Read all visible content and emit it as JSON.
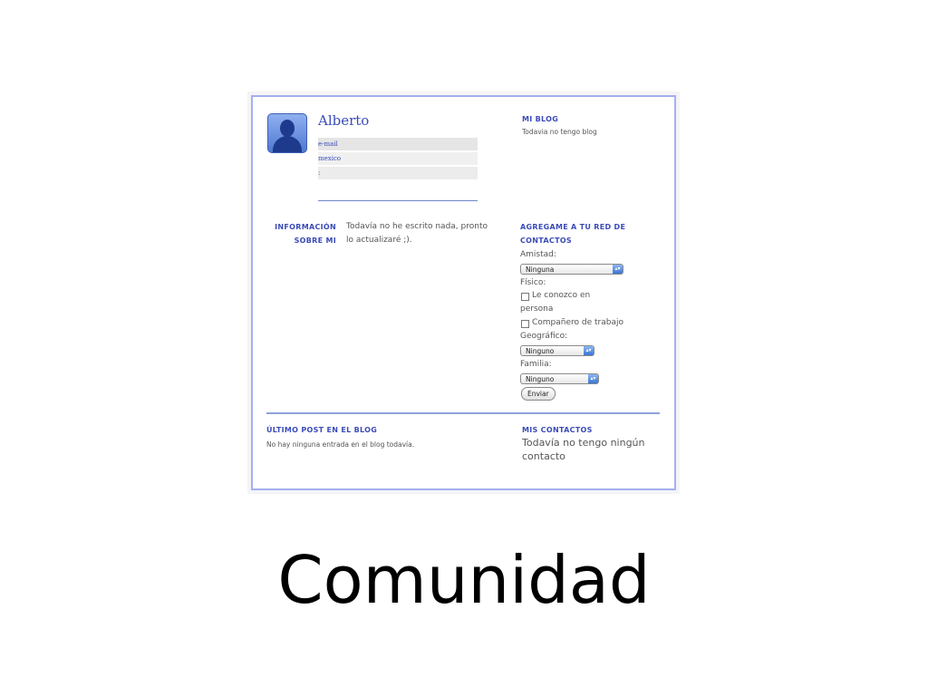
{
  "profile": {
    "name": "Alberto",
    "email": "e-mail",
    "location": "mexico",
    "extra": ":"
  },
  "blog": {
    "heading": "MI BLOG",
    "text": "Todavia no tengo blog"
  },
  "about": {
    "heading_line1": "INFORMACIÓN",
    "heading_line2": "SOBRE MI",
    "text_line1": "Todavía no he escrito nada, pronto",
    "text_line2": "lo actualizaré ;)."
  },
  "network": {
    "heading_line1": "AGREGAME A TU RED DE",
    "heading_line2": "CONTACTOS",
    "friendship_label": "Amistad:",
    "friendship_value": "Ninguna",
    "physical_label": "Físico:",
    "checkbox1_line1": "Le conozco en",
    "checkbox1_line2": "persona",
    "checkbox2": "Compañero de trabajo",
    "geo_label": "Geográfico:",
    "geo_value": "Ninguno",
    "family_label": "Familia:",
    "family_value": "Ninguno",
    "submit": "Enviar"
  },
  "last_post": {
    "heading": "ÚLTIMO POST EN EL BLOG",
    "text": "No hay ninguna entrada en el blog todavía."
  },
  "contacts": {
    "heading": "MIS CONTACTOS",
    "text_line1": "Todavía no tengo ningún",
    "text_line2": "contacto"
  },
  "caption": "Comunidad",
  "colors": {
    "accent": "#3a4bb8",
    "border": "#a4b0ee"
  },
  "icons": {
    "avatar": "user-silhouette-icon",
    "select_arrow": "up-down-arrow-icon"
  }
}
